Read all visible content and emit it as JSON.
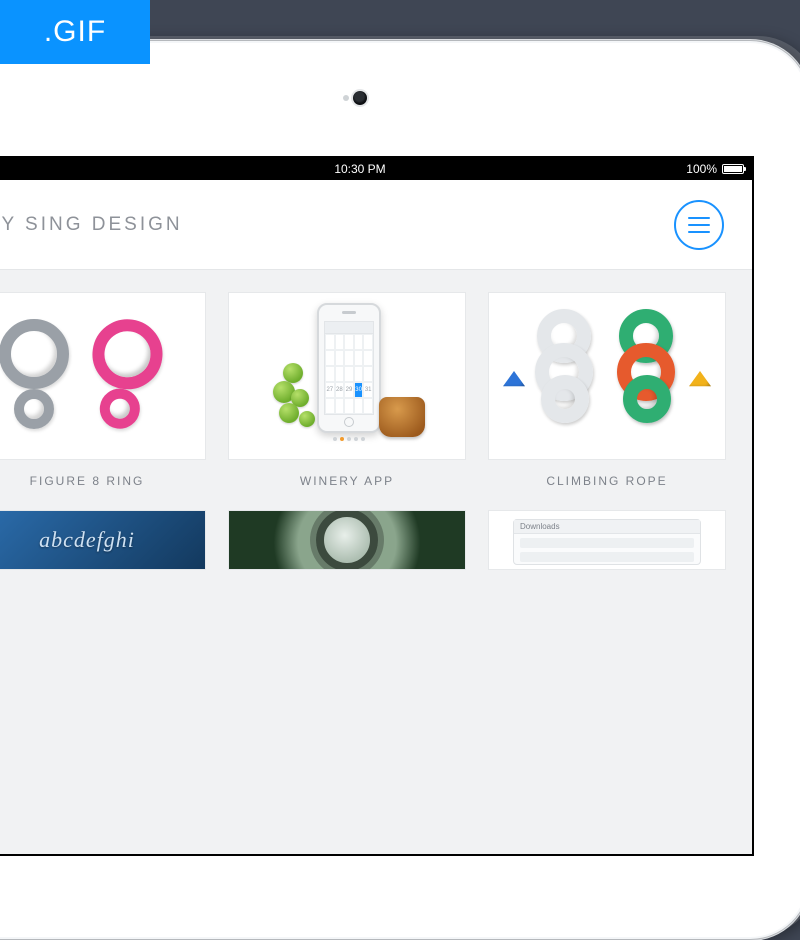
{
  "badge": {
    "label": ".GIF"
  },
  "statusbar": {
    "time": "10:30 PM",
    "battery_pct": "100%"
  },
  "header": {
    "title": "NNY SING DESIGN"
  },
  "grid": {
    "items": [
      {
        "caption": "FIGURE 8 RING"
      },
      {
        "caption": "WINERY APP"
      },
      {
        "caption": "CLIMBING ROPE"
      }
    ]
  },
  "winery": {
    "calendar_visible_dates": [
      "27",
      "28",
      "29",
      "30",
      "31"
    ],
    "selected_index": 3
  },
  "row2": {
    "downloads_label": "Downloads"
  }
}
